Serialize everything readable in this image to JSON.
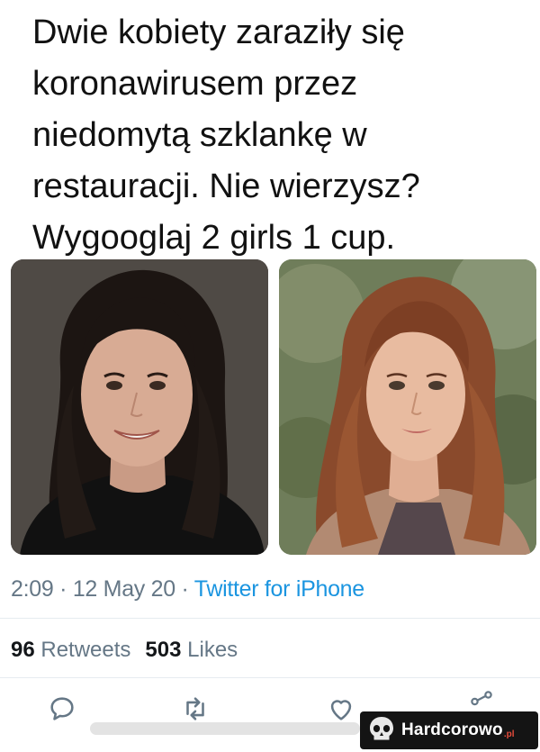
{
  "tweet": {
    "text": "Dwie kobiety zaraziły się\nkoronawirusem przez\nniedomytą szklankę w\nrestauracji. Nie wierzysz?\nWygooglaj 2 girls 1 cup.",
    "time": "2:09",
    "date": "12 May 20",
    "separator": "·",
    "source": "Twitter for iPhone",
    "source_color": "#1b95e0"
  },
  "stats": {
    "retweets_count": "96",
    "retweets_label": "Retweets",
    "likes_count": "503",
    "likes_label": "Likes"
  },
  "photos": [
    {
      "name": "dark-haired-woman-photo"
    },
    {
      "name": "auburn-haired-woman-photo"
    }
  ],
  "actions": [
    "reply-icon",
    "retweet-icon",
    "like-icon",
    "share-icon"
  ],
  "watermark": {
    "text": "Hardcorowo",
    "suffix": ".pl"
  }
}
